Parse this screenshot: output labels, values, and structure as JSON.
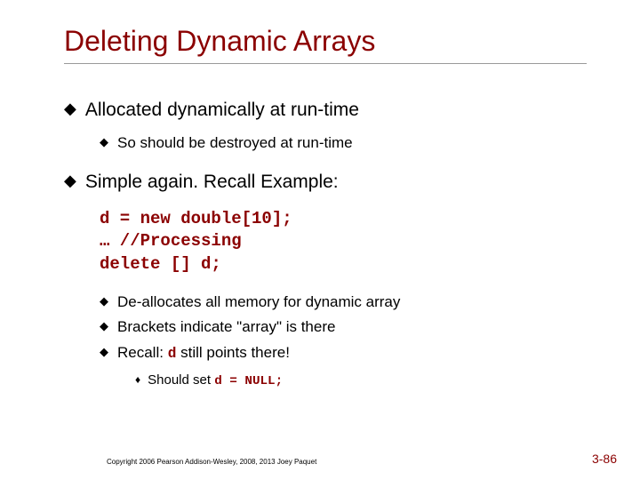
{
  "title": "Deleting Dynamic Arrays",
  "b1": {
    "text": "Allocated dynamically at run-time",
    "sub": [
      {
        "text": "So should be destroyed at run-time"
      }
    ]
  },
  "b2": {
    "text": "Simple again.  Recall Example:",
    "code": "d = new double[10];\n… //Processing\ndelete [] d;",
    "sub": [
      {
        "text": "De-allocates all memory for dynamic array"
      },
      {
        "text": "Brackets indicate \"array\" is there"
      },
      {
        "pre": "Recall: ",
        "code": "d",
        "post": " still points there!",
        "sub": {
          "pre": "Should set ",
          "code": "d = NULL;"
        }
      }
    ]
  },
  "footer": {
    "copyright": "Copyright 2006 Pearson Addison-Wesley, 2008, 2013 Joey Paquet",
    "pagenum": "3-86"
  }
}
